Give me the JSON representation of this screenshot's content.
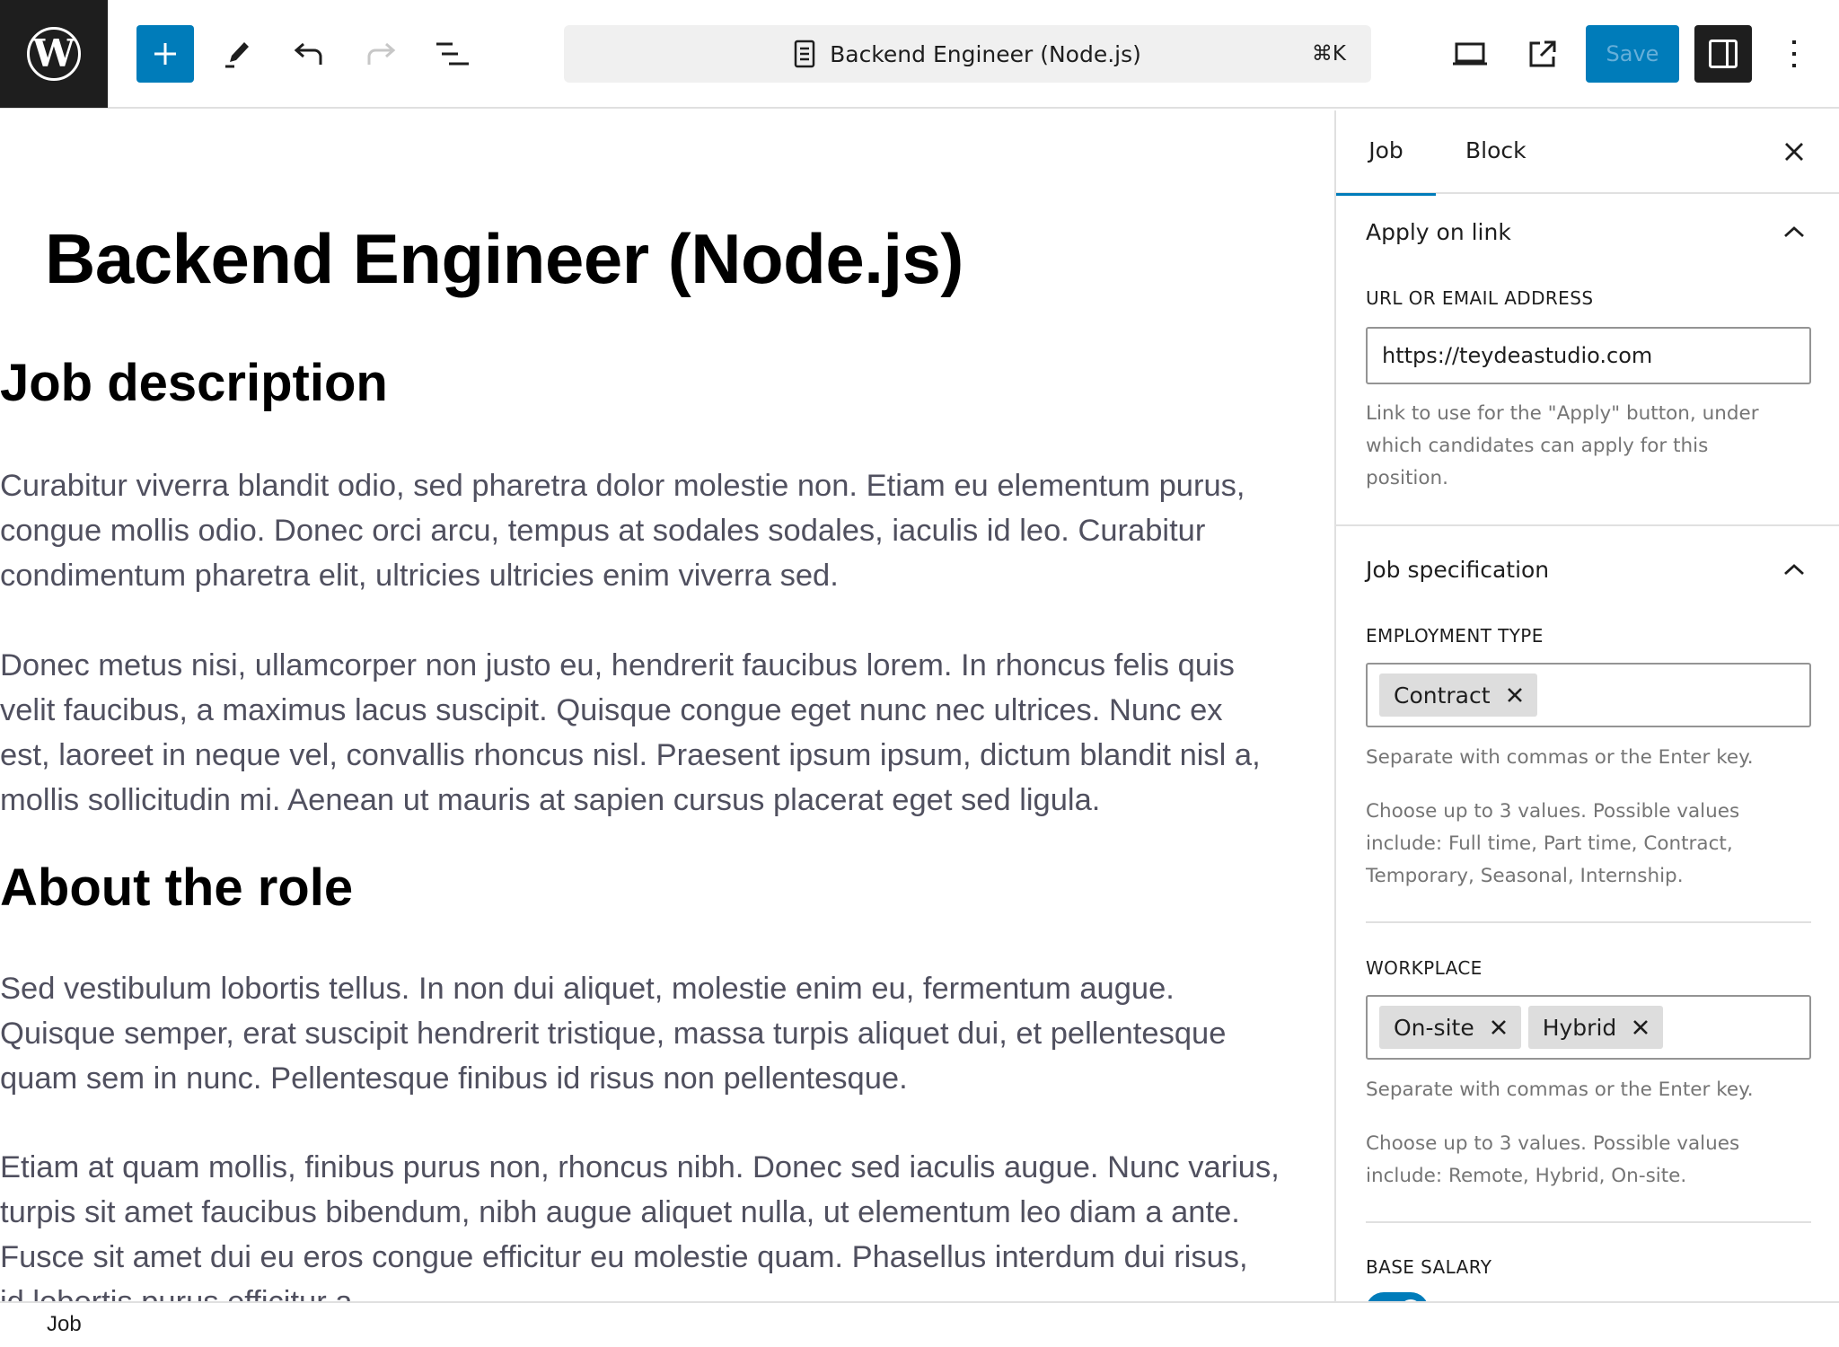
{
  "header": {
    "logo": "wordpress-logo",
    "add_block_icon": "plus-icon",
    "tools_icon": "pencil-icon",
    "undo_icon": "undo-icon",
    "redo_icon": "redo-icon",
    "list_view_icon": "list-view-icon",
    "document_title": "Backend Engineer (Node.js)",
    "document_icon": "page-icon",
    "shortcut": "⌘K",
    "view_icon": "laptop-icon",
    "preview_icon": "external-link-icon",
    "save_label": "Save",
    "settings_icon": "sidebar-toggle-icon",
    "more_icon": "more-vertical-icon",
    "colors": {
      "accent": "#007cba",
      "dark": "#1e1e1e"
    }
  },
  "editor": {
    "title": "Backend Engineer (Node.js)",
    "sections": [
      {
        "heading": "Job description",
        "paragraphs": [
          [
            "Curabitur viverra blandit odio, sed pharetra dolor molestie non. Etiam eu elementum purus,",
            "congue mollis odio. Donec orci arcu, tempus at sodales sodales, iaculis id leo. Curabitur",
            "condimentum pharetra elit, ultricies ultricies enim viverra sed."
          ],
          [
            "Donec metus nisi, ullamcorper non justo eu, hendrerit faucibus lorem. In rhoncus felis quis",
            "velit faucibus, a maximus lacus suscipit. Quisque congue eget nunc nec ultrices. Nunc ex",
            "est, laoreet in neque vel, convallis rhoncus nisl. Praesent ipsum ipsum, dictum blandit nisl a,",
            "mollis sollicitudin mi. Aenean ut mauris at sapien cursus placerat eget sed ligula."
          ]
        ]
      },
      {
        "heading": "About the role",
        "paragraphs": [
          [
            "Sed vestibulum lobortis tellus. In non dui aliquet, molestie enim eu, fermentum augue.",
            "Quisque semper, erat suscipit hendrerit tristique, massa turpis aliquet dui, et pellentesque",
            "quam sem in nunc. Pellentesque finibus id risus non pellentesque."
          ],
          [
            "Etiam at quam mollis, finibus purus non, rhoncus nibh. Donec sed iaculis augue. Nunc varius,",
            "turpis sit amet faucibus bibendum, nibh augue aliquet nulla, ut elementum leo diam a ante.",
            "Fusce sit amet dui eu eros congue efficitur eu molestie quam. Phasellus interdum dui risus,",
            "id lobortis purus efficitur a"
          ]
        ]
      }
    ]
  },
  "sidebar": {
    "tabs": [
      {
        "label": "Job",
        "active": true
      },
      {
        "label": "Block",
        "active": false
      }
    ],
    "close_icon": "close-icon",
    "panels": {
      "apply": {
        "title": "Apply on link",
        "expanded": true,
        "field_label": "URL OR EMAIL ADDRESS",
        "field_value": "https://teydeastudio.com",
        "help": [
          "Link to use for the \"Apply\" button, under",
          "which candidates can apply for this",
          "position."
        ]
      },
      "spec": {
        "title": "Job specification",
        "expanded": true,
        "employment": {
          "label": "EMPLOYMENT TYPE",
          "tokens": [
            "Contract"
          ],
          "help_separate": "Separate with commas or the Enter key.",
          "help_values": [
            "Choose up to 3 values. Possible values",
            "include: Full time, Part time, Contract,",
            "Temporary, Seasonal, Internship."
          ]
        },
        "workplace": {
          "label": "WORKPLACE",
          "tokens": [
            "On-site",
            "Hybrid"
          ],
          "help_separate": "Separate with commas or the Enter key.",
          "help_values": [
            "Choose up to 3 values. Possible values",
            "include: Remote, Hybrid, On-site."
          ]
        },
        "salary": {
          "label": "BASE SALARY",
          "toggle_on": true
        }
      }
    }
  },
  "footer": {
    "breadcrumb": "Job"
  }
}
